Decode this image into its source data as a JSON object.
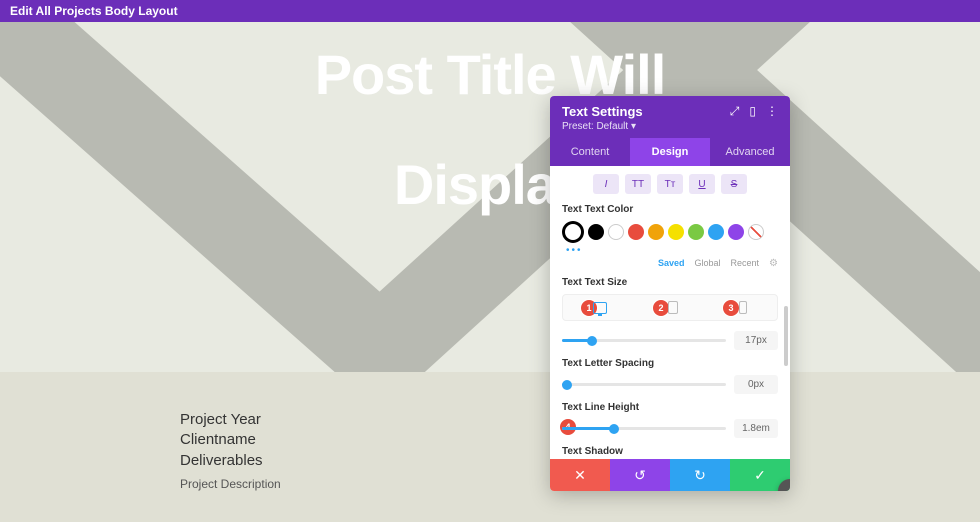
{
  "topbar": {
    "title": "Edit All Projects Body Layout"
  },
  "hero": {
    "line1": "Post Title Will",
    "line2": "Display"
  },
  "project": {
    "year": "Project Year",
    "client": "Clientname",
    "deliverables": "Deliverables",
    "description": "Project Description"
  },
  "panel": {
    "title": "Text Settings",
    "preset": "Preset: Default",
    "tabs": {
      "content": "Content",
      "design": "Design",
      "advanced": "Advanced"
    },
    "text_format": {
      "italic": "I",
      "allcaps": "TT",
      "smallcaps": "Tᴛ",
      "underline": "U",
      "strike": "S"
    },
    "labels": {
      "color": "Text Text Color",
      "size": "Text Text Size",
      "spacing": "Text Letter Spacing",
      "lineheight": "Text Line Height",
      "shadow": "Text Shadow"
    },
    "colors": [
      "#000000",
      "#000000",
      "#ffffff",
      "#e84c3d",
      "#f0a30a",
      "#f5e000",
      "#7ac943",
      "#2ea3f2",
      "#8e44e8",
      "#ffffff"
    ],
    "color_tabs": {
      "saved": "Saved",
      "global": "Global",
      "recent": "Recent"
    },
    "badges": {
      "b1": "1",
      "b2": "2",
      "b3": "3",
      "b4": "4"
    },
    "values": {
      "size": "17px",
      "spacing": "0px",
      "lineheight": "1.8em"
    },
    "sliders": {
      "size_pct": 18,
      "spacing_pct": 3,
      "lineheight_pct": 32
    },
    "footer_icons": {
      "cancel": "✕",
      "undo": "↺",
      "redo": "↻",
      "ok": "✓"
    }
  }
}
